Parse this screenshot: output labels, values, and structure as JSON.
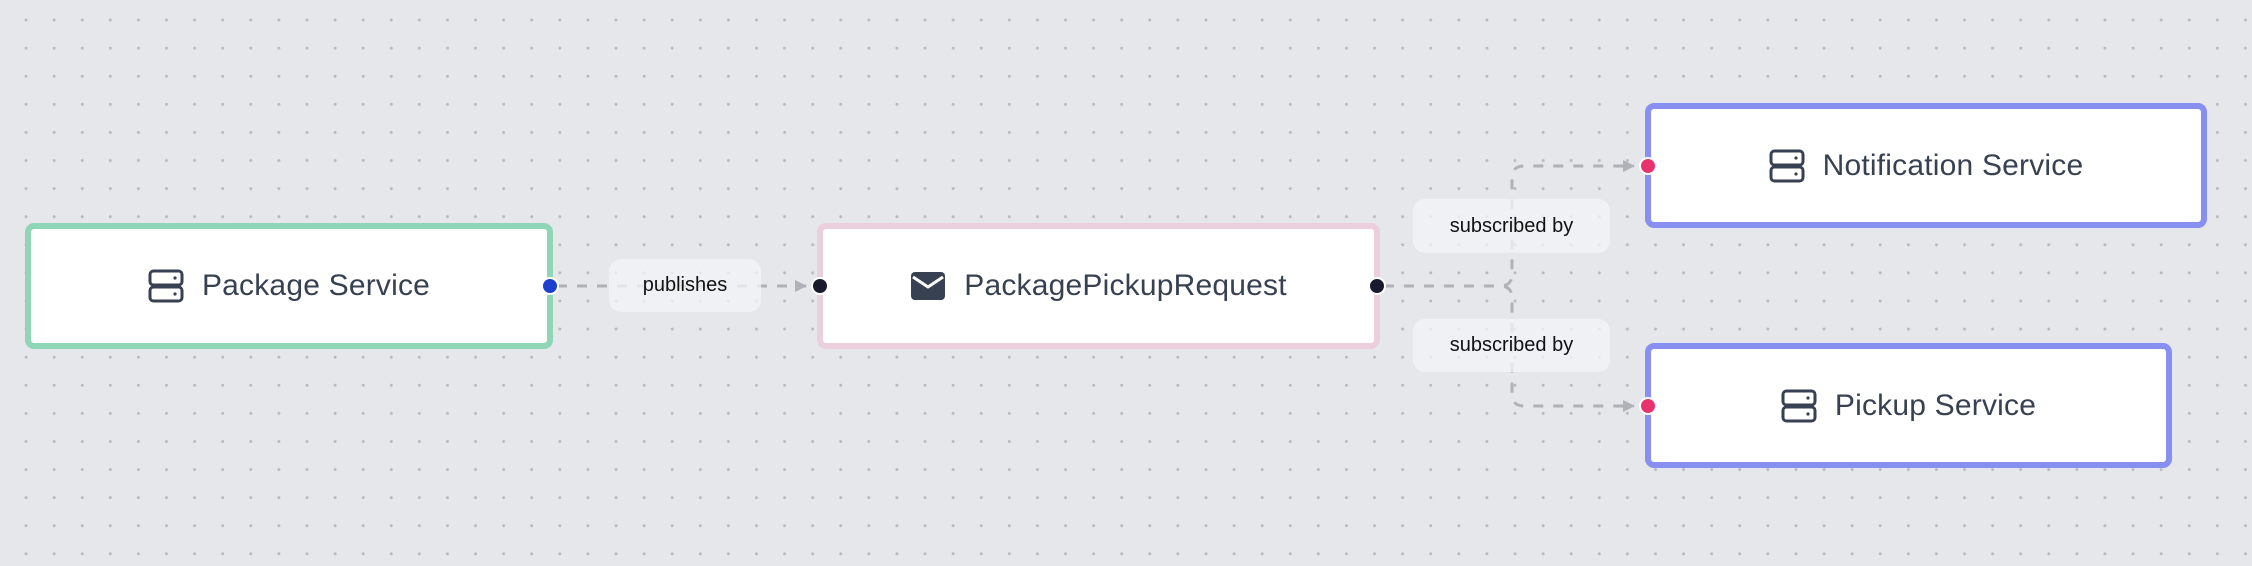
{
  "diagram": {
    "type": "event-flow",
    "background": "dot-grid",
    "nodes": [
      {
        "id": "package-service",
        "kind": "service",
        "label": "Package Service",
        "icon": "server-icon",
        "border_color": "#8fd6b7"
      },
      {
        "id": "package-pickup-request",
        "kind": "event",
        "label": "PackagePickupRequest",
        "icon": "envelope-icon",
        "border_color": "#ebcfdc"
      },
      {
        "id": "notification-service",
        "kind": "service",
        "label": "Notification Service",
        "icon": "server-icon",
        "border_color": "#878ff0"
      },
      {
        "id": "pickup-service",
        "kind": "service",
        "label": "Pickup Service",
        "icon": "server-icon",
        "border_color": "#878ff0"
      }
    ],
    "edges": [
      {
        "from": "package-service",
        "to": "package-pickup-request",
        "label": "publishes",
        "style": "dashed",
        "color": "#b1b1b7"
      },
      {
        "from": "package-pickup-request",
        "to": "notification-service",
        "label": "subscribed by",
        "style": "dashed",
        "color": "#b1b1b7"
      },
      {
        "from": "package-pickup-request",
        "to": "pickup-service",
        "label": "subscribed by",
        "style": "dashed",
        "color": "#b1b1b7"
      }
    ],
    "handle_colors": {
      "source_service": "#1d3fcf",
      "event": "#1a1a2e",
      "target_service": "#e8336d"
    }
  }
}
